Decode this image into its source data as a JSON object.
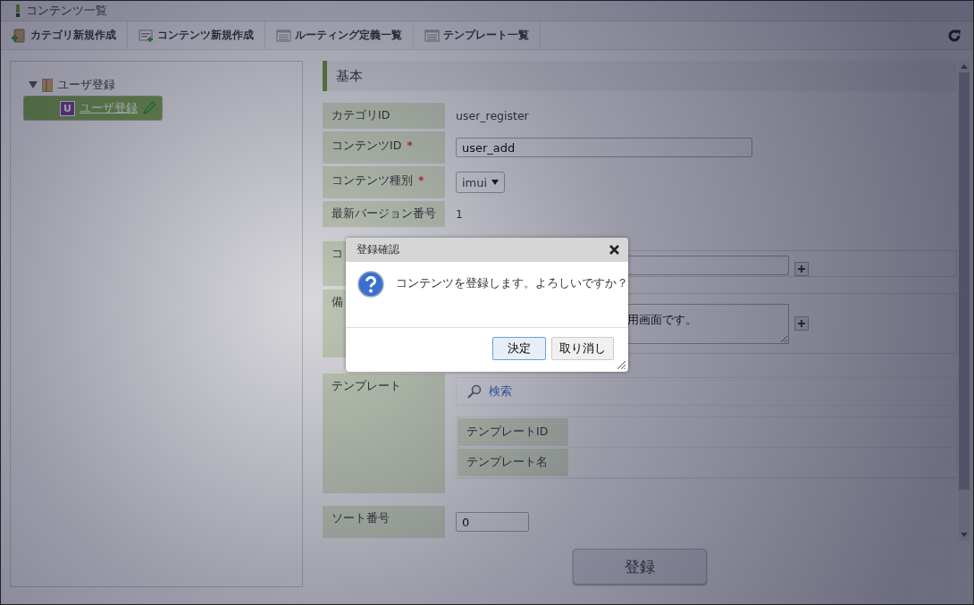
{
  "window": {
    "title": "コンテンツ一覧"
  },
  "toolbar": [
    {
      "label": "カテゴリ新規作成",
      "kind": "newcategory"
    },
    {
      "label": "コンテンツ新規作成",
      "kind": "newcontent"
    },
    {
      "label": "ルーティング定義一覧",
      "kind": "list"
    },
    {
      "label": "テンプレート一覧",
      "kind": "list"
    }
  ],
  "tree": [
    {
      "label": "ユーザ登録",
      "expanded": true,
      "selected": false,
      "children": [
        {
          "label": "ユーザ登録",
          "badge": "U",
          "selected": true
        }
      ]
    }
  ],
  "section": {
    "title": "基本"
  },
  "form": [
    {
      "kind": "text",
      "label": "カテゴリID",
      "value": "user_register"
    },
    {
      "kind": "input",
      "label": "コンテンツID",
      "required_mark": "*",
      "value": "user_add"
    },
    {
      "kind": "select",
      "label": "コンテンツ種別",
      "required_mark": "*",
      "value": "imui"
    },
    {
      "kind": "text",
      "label": "最新バージョン番号",
      "value": "1"
    },
    {
      "kind": "inputplus",
      "label": "コ"
    },
    {
      "kind": "textareaplus",
      "label": "備",
      "value": "用画面です。"
    },
    {
      "kind": "template",
      "label": "テンプレート",
      "search": "検索",
      "fields": [
        "テンプレートID",
        "テンプレート名"
      ]
    },
    {
      "kind": "small",
      "label": "ソート番号",
      "value": "0"
    }
  ],
  "submit_button": "登録",
  "dialog": {
    "title": "登録確認",
    "message": "コンテンツを登録します。よろしいですか？",
    "buttons": [
      {
        "label": "決定",
        "focused": true
      },
      {
        "label": "取り消し",
        "focused": false
      }
    ]
  }
}
